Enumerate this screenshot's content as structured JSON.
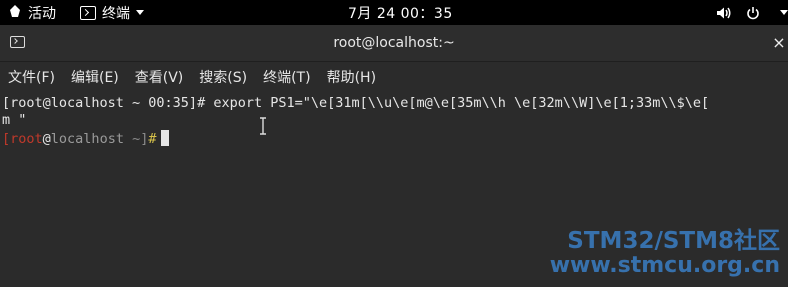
{
  "topbar": {
    "activities_label": "活动",
    "app_label": "终端",
    "clock": "7月 24  00：35"
  },
  "window": {
    "title": "root@localhost:~",
    "close_glyph": "×"
  },
  "menu": {
    "items": [
      "文件(F)",
      "编辑(E)",
      "查看(V)",
      "搜索(S)",
      "终端(T)",
      "帮助(H)"
    ]
  },
  "terminal": {
    "line1": "[root@localhost ~ 00:35]# export PS1=\"\\e[31m[\\\\u\\e[m@\\e[35m\\\\h \\e[32m\\\\W]\\e[1;33m\\\\$\\e[",
    "line2": "m \"",
    "prompt": {
      "open": "[",
      "user": "root",
      "at": "@",
      "host": "localhost",
      "space": " ",
      "dir": "~",
      "close": "]",
      "symbol": "#"
    }
  },
  "watermark": {
    "line1": "STM32/STM8社区",
    "line2": "www.stmcu.org.cn"
  },
  "colors": {
    "terminal_bg": "#2b2b2b",
    "prompt_user": "#c0392b",
    "prompt_host": "#9a9a9a",
    "prompt_dir": "#8a8a8a",
    "prompt_symbol": "#d7c24a",
    "watermark": "#3a7ec4"
  }
}
